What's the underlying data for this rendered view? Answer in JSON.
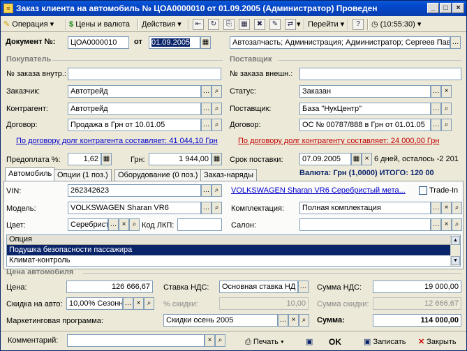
{
  "window": {
    "title": "Заказ клиента на автомобиль № ЦОА0000010 от 01.09.2005 (Администратор) Проведен"
  },
  "toolbar": {
    "operation": "Операция",
    "prices": "Цены и валюта",
    "actions": "Действия",
    "goto": "Перейти",
    "help": "?",
    "time": "(10:55:30)"
  },
  "doc": {
    "label": "Документ №:",
    "number": "ЦОА0000010",
    "from_label": "от",
    "date": "01.09.2005",
    "info": "Автозапчасть; Администрация; Администратор; Сергеев Пав"
  },
  "buyer": {
    "header": "Покупатель",
    "internal_no_label": "№ заказа внутр.:",
    "internal_no": "",
    "customer_label": "Заказчик:",
    "customer": "Автотрейд",
    "counterparty_label": "Контрагент:",
    "counterparty": "Автотрейд",
    "contract_label": "Договор:",
    "contract": "Продажа в Грн от 10.01.05",
    "debt_link": "По договору долг контрагента составляет: 41 044,10 Грн",
    "prepay_label": "Предоплата %:",
    "prepay": "1,62",
    "grn_label": "Грн:",
    "grn": "1 944,00"
  },
  "supplier": {
    "header": "Поставщик",
    "external_no_label": "№ заказа внешн.:",
    "external_no": "",
    "status_label": "Статус:",
    "status": "Заказан",
    "supplier_label": "Поставщик:",
    "supplier": "База \"НукЦентр\"",
    "contract_label": "Договор:",
    "contract": "ОС № 00787/888 в Грн от 01.01.05",
    "debt_link": "По договору долг контрагенту составляет: 24 000,00 Грн",
    "delivery_label": "Срок поставки:",
    "delivery": "07.09.2005",
    "delivery_note": "6 дней, осталось -2 201",
    "total": "Валюта: Грн (1,0000) ИТОГО: 120 00"
  },
  "tabs": [
    "Автомобиль",
    "Опции (1 поз.)",
    "Оборудование (0 поз.)",
    "Заказ-наряды"
  ],
  "car": {
    "vin_label": "VIN:",
    "vin": "262342623",
    "car_link": "VOLKSWAGEN Sharan VR6 Серебристый мета...",
    "tradein_label": "Trade-In",
    "model_label": "Модель:",
    "model": "VOLKSWAGEN Sharan VR6",
    "equipment_label": "Комплектация:",
    "equipment": "Полная комплектация",
    "color_label": "Цвет:",
    "color": "Серебрист",
    "lkp_label": "Код ЛКП:",
    "lkp": "",
    "salon_label": "Салон:",
    "salon": "",
    "options_header": "Опция",
    "options": [
      "Подушка безопасности пассажира",
      "Климат-контроль"
    ]
  },
  "price": {
    "header": "Цена автомобиля",
    "price_label": "Цена:",
    "price": "126 666,67",
    "vat_rate_label": "Ставка НДС:",
    "vat_rate": "Основная ставка НД",
    "vat_sum_label": "Сумма НДС:",
    "vat_sum": "19 000,00",
    "discount_label": "Скидка на авто:",
    "discount": "10,00% Сезонн",
    "discount_pct_label": "% скидки:",
    "discount_pct": "10,00",
    "discount_sum_label": "Сумма скидки:",
    "discount_sum": "12 666,67",
    "marketing_label": "Маркетинговая программа:",
    "marketing": "Скидки осень 2005",
    "sum_label": "Сумма:",
    "sum": "114 000,00"
  },
  "footer": {
    "comment_label": "Комментарий:",
    "comment": "",
    "print": "Печать",
    "ok": "OK",
    "save": "Записать",
    "close": "Закрыть"
  }
}
